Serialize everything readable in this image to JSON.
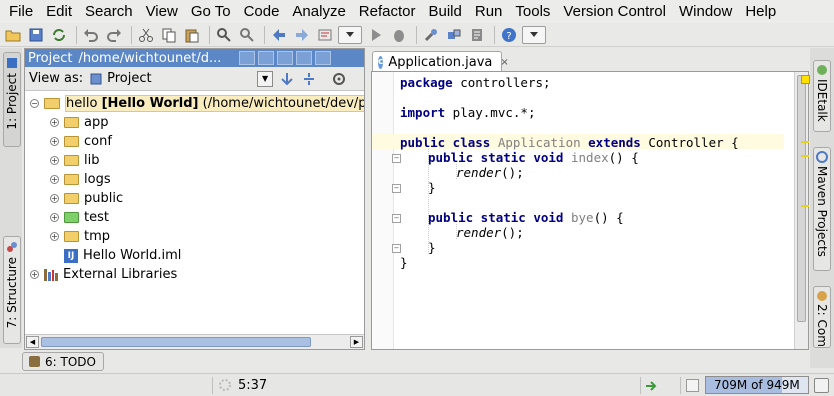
{
  "menu": [
    "File",
    "Edit",
    "Search",
    "View",
    "Go To",
    "Code",
    "Analyze",
    "Refactor",
    "Build",
    "Run",
    "Tools",
    "Version Control",
    "Window",
    "Help"
  ],
  "toolbar": {
    "icons": [
      "open-icon",
      "save-icon",
      "sync-icon",
      "undo-icon",
      "redo-icon",
      "cut-icon",
      "copy-icon",
      "paste-icon",
      "find-icon",
      "replace-icon",
      "back-icon",
      "forward-icon",
      "build-icon",
      "run-config-dropdown",
      "run-icon",
      "debug-icon",
      "settings-icon",
      "structure-icon",
      "vcs-icon",
      "help-icon",
      "more-dropdown"
    ]
  },
  "left_tabs": {
    "project": "1: Project",
    "structure": "7: Structure"
  },
  "right_tabs": {
    "idetalk": "IDEtalk",
    "maven": "Maven Projects",
    "commander": "2: Com"
  },
  "project_panel": {
    "title": "Project",
    "path": "/home/wichtounet/d...",
    "view_as_label": "View as:",
    "view_as_value": "Project",
    "tree": {
      "root_name": "hello",
      "root_module": "[Hello World]",
      "root_path": "(/home/wichtounet/dev/play",
      "children": [
        {
          "label": "app",
          "kind": "folder"
        },
        {
          "label": "conf",
          "kind": "folder"
        },
        {
          "label": "lib",
          "kind": "folder"
        },
        {
          "label": "logs",
          "kind": "folder"
        },
        {
          "label": "public",
          "kind": "folder"
        },
        {
          "label": "test",
          "kind": "test-folder"
        },
        {
          "label": "tmp",
          "kind": "folder"
        },
        {
          "label": "Hello World.iml",
          "kind": "iml"
        }
      ],
      "external": "External Libraries"
    }
  },
  "editor": {
    "tab_label": "Application.java",
    "code": {
      "l1_kw": "package",
      "l1_rest": " controllers;",
      "l2_kw": "import",
      "l2_rest": " play.mvc.*;",
      "l3_kw1": "public class",
      "l3_cls": " Application",
      "l3_kw2": " extends",
      "l3_rest": " Controller {",
      "l4_kw": "public static void",
      "l4_fn": " index",
      "l4_rest": "() {",
      "l5": "render",
      "l5_rest": "();",
      "l6": "}",
      "l7_kw": "public static void",
      "l7_fn": " bye",
      "l7_rest": "() {",
      "l8": "render",
      "l8_rest": "();",
      "l9": "}",
      "l10": "}"
    }
  },
  "todo_tab": "6: TODO",
  "status": {
    "position": "5:37",
    "memory": "709M of 949M",
    "memory_used_fraction": 0.747
  }
}
